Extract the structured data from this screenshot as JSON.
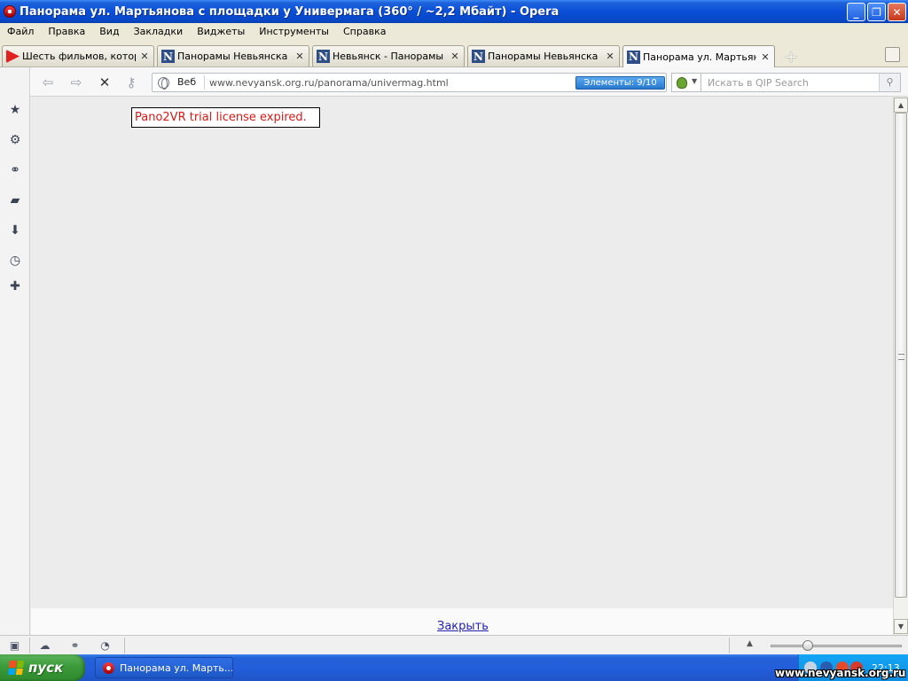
{
  "window": {
    "title": "Панорама ул. Мартьянова с площадки у Универмага (360° / ~2,2 Мбайт) - Opera",
    "buttons": {
      "minimize": "_",
      "maximize": "❐",
      "close": "✕"
    }
  },
  "menu": {
    "items": [
      "Файл",
      "Правка",
      "Вид",
      "Закладки",
      "Виджеты",
      "Инструменты",
      "Справка"
    ]
  },
  "tabs": [
    {
      "label": "Шесть фильмов, котор...",
      "icon": "youtube-icon",
      "active": false
    },
    {
      "label": "Панорамы Невьянска (...",
      "icon": "n-site-icon",
      "active": false
    },
    {
      "label": "Невьянск - Панорамы Н...",
      "icon": "n-site-icon",
      "active": false
    },
    {
      "label": "Панорамы Невьянска (...",
      "icon": "n-site-icon",
      "active": false
    },
    {
      "label": "Панорама ул. Мартьян...",
      "icon": "n-site-icon",
      "active": true
    }
  ],
  "tab_close_glyph": "✕",
  "tab_new_glyph": "+",
  "sidebar": {
    "icons": [
      "bookmarks-star-icon",
      "settings-gear-icon",
      "share-unite-icon",
      "notes-icon",
      "downloads-icon",
      "history-clock-icon",
      "add-panel-icon"
    ]
  },
  "address_bar": {
    "scope_label": "Веб",
    "url_host": "www.nevyansk.org.ru",
    "url_path": "/panorama/univermag.html",
    "elements_badge": "Элементы:   9/10",
    "search_placeholder": "Искать в QIP Search"
  },
  "content": {
    "notice": "Pano2VR trial license expired.",
    "close_link": "Закрыть"
  },
  "taskbar": {
    "start_label": "пуск",
    "task_label": "Панорама ул. Марть...",
    "clock": "22:13"
  },
  "watermark": "www.nevyansk.org.ru",
  "colors": {
    "titlebar": "#0a4fd8",
    "notice_text": "#d21b1b",
    "link": "#1f1fa8",
    "elements_badge": "#2779cf"
  }
}
